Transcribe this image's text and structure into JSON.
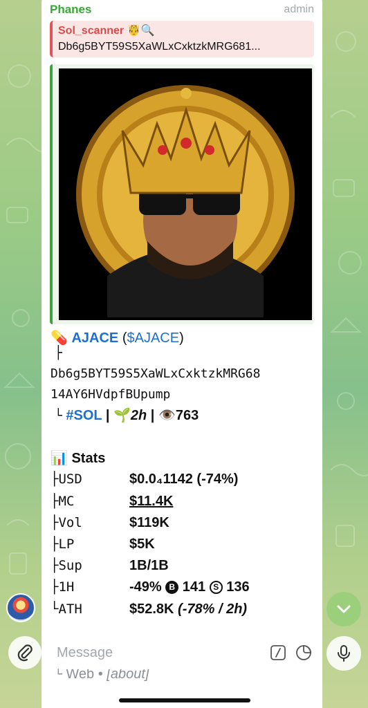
{
  "message": {
    "sender": "Phanes",
    "role": "admin",
    "reply": {
      "name": "Sol_scanner 🤴🔍",
      "text": "Db6g5BYT59S5XaWLxCxktzkMRG681..."
    },
    "token": {
      "pill_emoji": "💊",
      "name": "AJACE",
      "ticker_open": " (",
      "ticker": "$AJACE",
      "ticker_close": ")",
      "tree_top": "├",
      "address_line1": "Db6g5BYT59S5XaWLxCxktzkMRG68",
      "address_line2": "14AY6HVdpfBUpump",
      "tree_bottom": "└",
      "chain": "#SOL",
      "sep": " | ",
      "sprout_emoji": "🌱",
      "age": "2h",
      "eye_emoji": "👁️",
      "views": "763"
    },
    "stats": {
      "icon": "📊",
      "title": "Stats",
      "rows": [
        {
          "label": "├USD",
          "value": "$0.0₄1142 (-74%)"
        },
        {
          "label": "├MC",
          "value": "$11.4K"
        },
        {
          "label": "├Vol",
          "value": "$119K"
        },
        {
          "label": "├LP",
          "value": "$5K"
        },
        {
          "label": "├Sup",
          "value": "1B/1B"
        },
        {
          "label": "├1H",
          "value_prefix": "-49% ",
          "b_glyph": "B",
          "buys": " 141 ",
          "s_glyph": "S",
          "sells": " 136"
        },
        {
          "label": "└ATH",
          "value": "$52.8K",
          "value_extra": " (-78% / 2h)"
        }
      ]
    },
    "footer": {
      "tree": "└",
      "web": "Web",
      "dot": " • ",
      "about": "[about]"
    }
  },
  "composer": {
    "placeholder": "Message"
  },
  "icons": {
    "attach": "paperclip-icon",
    "commands": "slash-command-icon",
    "sticker": "sticker-icon",
    "mic": "microphone-icon",
    "scroll": "chevron-down-icon"
  },
  "colors": {
    "sender": "#3aa637",
    "link": "#1c6fd0",
    "reply_accent": "#e45454",
    "media_accent": "#3ea33a"
  }
}
